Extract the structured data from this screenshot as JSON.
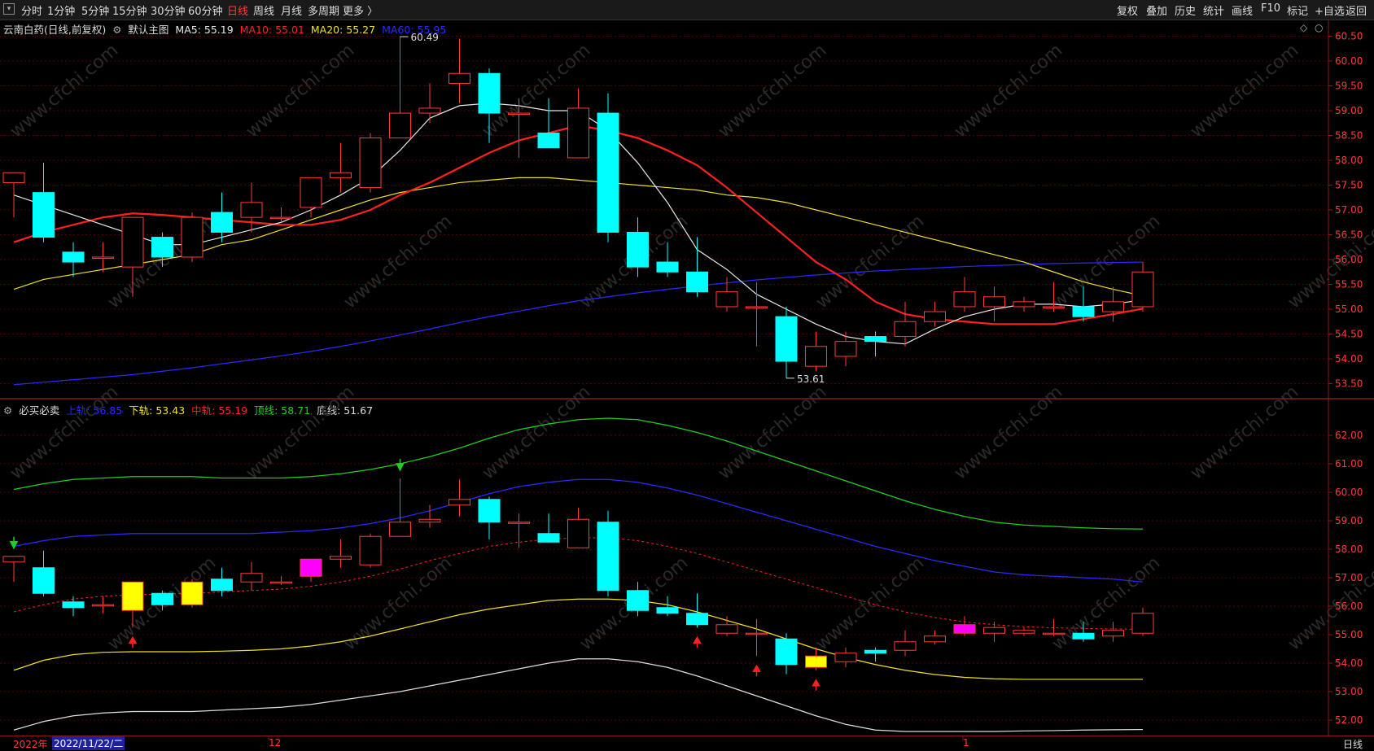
{
  "toolbar": {
    "left": [
      "分时",
      "1分钟",
      "5分钟",
      "15分钟",
      "30分钟",
      "60分钟",
      "日线",
      "周线",
      "月线",
      "多周期",
      "更多 〉"
    ],
    "active_index": 6,
    "right": [
      "复权",
      "叠加",
      "历史",
      "统计",
      "画线",
      "F10",
      "标记",
      "+自选",
      "返回"
    ]
  },
  "main": {
    "stock": "云南白药(日线,前复权)",
    "indicator": "默认主图",
    "ma": [
      {
        "label": "MA5: 55.19",
        "color": "#e8e8e8"
      },
      {
        "label": "MA10: 55.01",
        "color": "#ff2020"
      },
      {
        "label": "MA20: 55.27",
        "color": "#f0e020"
      },
      {
        "label": "MA60: 55.95",
        "color": "#2a2aff"
      }
    ],
    "y_ticks": [
      "60.50",
      "60.00",
      "59.50",
      "59.00",
      "58.50",
      "58.00",
      "57.50",
      "57.00",
      "56.50",
      "56.00",
      "55.50",
      "55.00",
      "54.50",
      "54.00",
      "53.50"
    ],
    "high_label": "60.49",
    "low_label": "53.61"
  },
  "sub": {
    "name": "必买必卖",
    "lines": [
      {
        "label": "上轨: 56.85",
        "color": "#2a2aff"
      },
      {
        "label": "下轨: 53.43",
        "color": "#f0e020"
      },
      {
        "label": "中轨: 55.19",
        "color": "#ff2020"
      },
      {
        "label": "顶线: 58.71",
        "color": "#20d020"
      },
      {
        "label": "底线: 51.67",
        "color": "#dddddd"
      }
    ],
    "y_ticks": [
      "62.00",
      "61.00",
      "60.00",
      "59.00",
      "58.00",
      "57.00",
      "56.00",
      "55.00",
      "54.00",
      "53.00",
      "52.00"
    ]
  },
  "bottom": {
    "year": "2022年",
    "date": "2022/11/22/二",
    "tick_dec": "12",
    "tick_jan": "1",
    "timeframe": "日线"
  },
  "watermark": "www.cfchi.com",
  "colors": {
    "up": "#ff3b3b",
    "down": "#00ffff",
    "ma5": "#e8e8e8",
    "ma10": "#ff2020",
    "ma20": "#f0e020",
    "ma60": "#2a2aff",
    "top": "#20d020",
    "bottom": "#dddddd",
    "grid": "#5a0000"
  },
  "chart_data": {
    "type": "candlestick",
    "ohlc": [
      [
        57.55,
        57.75,
        56.85,
        57.75
      ],
      [
        57.35,
        57.95,
        56.35,
        56.45
      ],
      [
        56.15,
        56.35,
        55.65,
        55.95
      ],
      [
        56.05,
        56.35,
        55.75,
        56.05
      ],
      [
        55.85,
        56.85,
        55.25,
        56.85
      ],
      [
        56.45,
        56.55,
        55.85,
        56.05
      ],
      [
        56.05,
        56.95,
        55.95,
        56.85
      ],
      [
        56.95,
        57.35,
        56.35,
        56.55
      ],
      [
        56.85,
        57.55,
        56.55,
        57.15
      ],
      [
        56.85,
        57.05,
        56.75,
        56.85
      ],
      [
        57.05,
        57.65,
        56.85,
        57.65
      ],
      [
        57.65,
        58.35,
        57.35,
        57.75
      ],
      [
        57.45,
        58.55,
        57.35,
        58.45
      ],
      [
        58.45,
        60.49,
        58.45,
        58.95
      ],
      [
        58.95,
        59.55,
        58.75,
        59.05
      ],
      [
        59.55,
        60.45,
        59.15,
        59.75
      ],
      [
        59.75,
        59.85,
        58.35,
        58.95
      ],
      [
        58.95,
        59.25,
        58.05,
        58.95
      ],
      [
        58.55,
        59.25,
        58.25,
        58.25
      ],
      [
        58.05,
        59.45,
        58.05,
        59.05
      ],
      [
        58.95,
        59.35,
        56.35,
        56.55
      ],
      [
        56.55,
        56.85,
        55.65,
        55.85
      ],
      [
        55.95,
        56.35,
        55.65,
        55.75
      ],
      [
        55.75,
        56.45,
        55.25,
        55.35
      ],
      [
        55.05,
        55.65,
        54.95,
        55.35
      ],
      [
        55.05,
        55.55,
        54.25,
        55.05
      ],
      [
        54.85,
        55.05,
        53.61,
        53.95
      ],
      [
        53.85,
        54.55,
        53.75,
        54.25
      ],
      [
        54.05,
        54.55,
        53.85,
        54.35
      ],
      [
        54.45,
        54.55,
        54.05,
        54.35
      ],
      [
        54.45,
        55.15,
        54.25,
        54.75
      ],
      [
        54.75,
        55.15,
        54.65,
        54.95
      ],
      [
        55.05,
        55.65,
        54.95,
        55.35
      ],
      [
        55.05,
        55.45,
        54.75,
        55.25
      ],
      [
        55.05,
        55.25,
        54.95,
        55.15
      ],
      [
        55.05,
        55.55,
        54.95,
        55.05
      ],
      [
        55.05,
        55.45,
        54.75,
        54.85
      ],
      [
        54.95,
        55.45,
        54.75,
        55.15
      ],
      [
        55.05,
        55.95,
        54.95,
        55.75
      ]
    ],
    "ma5": [
      57.3,
      57.1,
      56.9,
      56.7,
      56.5,
      56.3,
      56.3,
      56.45,
      56.6,
      56.75,
      57.0,
      57.3,
      57.65,
      58.2,
      58.85,
      59.1,
      59.15,
      59.1,
      59.0,
      59.0,
      58.6,
      57.95,
      57.15,
      56.2,
      55.8,
      55.3,
      55.0,
      54.7,
      54.45,
      54.35,
      54.3,
      54.6,
      54.85,
      55.0,
      55.1,
      55.1,
      55.05,
      55.1,
      55.19
    ],
    "ma10": [
      56.35,
      56.55,
      56.7,
      56.85,
      56.93,
      56.9,
      56.85,
      56.8,
      56.75,
      56.7,
      56.7,
      56.8,
      57.0,
      57.3,
      57.55,
      57.85,
      58.15,
      58.4,
      58.55,
      58.7,
      58.6,
      58.45,
      58.2,
      57.9,
      57.45,
      56.95,
      56.45,
      55.95,
      55.6,
      55.15,
      54.9,
      54.8,
      54.75,
      54.7,
      54.7,
      54.7,
      54.8,
      54.9,
      55.01
    ],
    "ma20": [
      55.4,
      55.6,
      55.7,
      55.8,
      55.9,
      56.0,
      56.1,
      56.3,
      56.4,
      56.6,
      56.8,
      57.0,
      57.2,
      57.35,
      57.45,
      57.55,
      57.6,
      57.65,
      57.65,
      57.6,
      57.55,
      57.5,
      57.45,
      57.4,
      57.3,
      57.25,
      57.15,
      57.0,
      56.85,
      56.7,
      56.55,
      56.4,
      56.25,
      56.1,
      55.95,
      55.75,
      55.55,
      55.4,
      55.27
    ],
    "ma60": [
      53.48,
      53.53,
      53.58,
      53.63,
      53.68,
      53.75,
      53.82,
      53.9,
      53.98,
      54.06,
      54.15,
      54.25,
      54.36,
      54.48,
      54.6,
      54.73,
      54.85,
      54.96,
      55.07,
      55.17,
      55.25,
      55.33,
      55.4,
      55.47,
      55.53,
      55.59,
      55.64,
      55.69,
      55.73,
      55.77,
      55.8,
      55.83,
      55.86,
      55.88,
      55.9,
      55.92,
      55.93,
      55.94,
      55.95
    ],
    "sub": {
      "upper": [
        58.1,
        58.3,
        58.45,
        58.5,
        58.55,
        58.55,
        58.55,
        58.55,
        58.55,
        58.6,
        58.65,
        58.75,
        58.9,
        59.1,
        59.35,
        59.65,
        59.95,
        60.2,
        60.35,
        60.45,
        60.45,
        60.35,
        60.15,
        59.9,
        59.6,
        59.3,
        59.0,
        58.7,
        58.4,
        58.1,
        57.85,
        57.6,
        57.4,
        57.2,
        57.1,
        57.05,
        57.0,
        56.95,
        56.85
      ],
      "middle": [
        55.8,
        56.05,
        56.25,
        56.35,
        56.4,
        56.42,
        56.45,
        56.5,
        56.55,
        56.6,
        56.7,
        56.85,
        57.05,
        57.3,
        57.6,
        57.85,
        58.1,
        58.25,
        58.35,
        58.4,
        58.4,
        58.3,
        58.1,
        57.85,
        57.55,
        57.25,
        56.95,
        56.65,
        56.35,
        56.05,
        55.8,
        55.6,
        55.45,
        55.35,
        55.28,
        55.24,
        55.22,
        55.2,
        55.19
      ],
      "lower": [
        53.75,
        54.1,
        54.3,
        54.38,
        54.4,
        54.4,
        54.4,
        54.42,
        54.45,
        54.5,
        54.6,
        54.75,
        54.95,
        55.2,
        55.45,
        55.7,
        55.9,
        56.05,
        56.2,
        56.25,
        56.25,
        56.2,
        56.05,
        55.8,
        55.5,
        55.2,
        54.85,
        54.5,
        54.2,
        53.95,
        53.75,
        53.6,
        53.5,
        53.45,
        53.43,
        53.43,
        53.43,
        53.43,
        53.43
      ],
      "top": [
        60.1,
        60.3,
        60.45,
        60.5,
        60.55,
        60.55,
        60.55,
        60.5,
        60.5,
        60.5,
        60.55,
        60.65,
        60.8,
        61.0,
        61.25,
        61.55,
        61.9,
        62.2,
        62.4,
        62.55,
        62.6,
        62.55,
        62.35,
        62.1,
        61.8,
        61.45,
        61.1,
        60.75,
        60.4,
        60.05,
        59.7,
        59.4,
        59.15,
        58.95,
        58.85,
        58.8,
        58.75,
        58.72,
        58.71
      ],
      "bottom": [
        51.65,
        51.95,
        52.15,
        52.25,
        52.3,
        52.3,
        52.3,
        52.35,
        52.4,
        52.45,
        52.55,
        52.7,
        52.85,
        53.0,
        53.2,
        53.4,
        53.6,
        53.8,
        54.0,
        54.15,
        54.15,
        54.05,
        53.85,
        53.55,
        53.2,
        52.85,
        52.5,
        52.15,
        51.85,
        51.65,
        51.6,
        51.6,
        51.6,
        51.6,
        51.62,
        51.63,
        51.65,
        51.66,
        51.67
      ],
      "yellow_idx": [
        4,
        6,
        27
      ],
      "magenta_idx": [
        10,
        32
      ],
      "down_arrow_idx": [
        0,
        13
      ],
      "up_arrow_idx": [
        4,
        23,
        25,
        27
      ]
    }
  }
}
